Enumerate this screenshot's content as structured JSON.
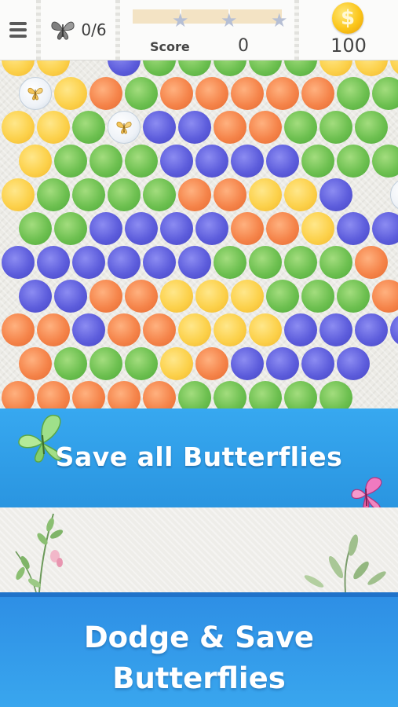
{
  "hud": {
    "menu_icon": "hamburger-menu-icon",
    "butterfly_icon": "butterfly-icon",
    "butterflies_saved": "0/6",
    "score_label": "Score",
    "score_value": "0",
    "coin_icon": "dollar-coin-icon",
    "coin_symbol": "$",
    "coins": "100",
    "star_progress": 0
  },
  "board": {
    "colors": {
      "g": "#6dc050",
      "o": "#f5844a",
      "b": "#5d5ddc",
      "y": "#fcd14b"
    },
    "rows": [
      "yy.bgggggyyy",
      "Fyogooooogg",
      "yygFbbooggg",
      "ygggbbbbggg",
      "yggggooyyb F",
      "ggbbbbooybby",
      "bbbbbbggggo",
      "bbooyyygggoo",
      "oobooyyybbbb",
      "ogggyobbbb",
      "oooooggggg"
    ]
  },
  "banner": {
    "text": "Save all Butterflies"
  },
  "promo": {
    "line1": "Dodge & Save",
    "line2": "Butterflies"
  }
}
